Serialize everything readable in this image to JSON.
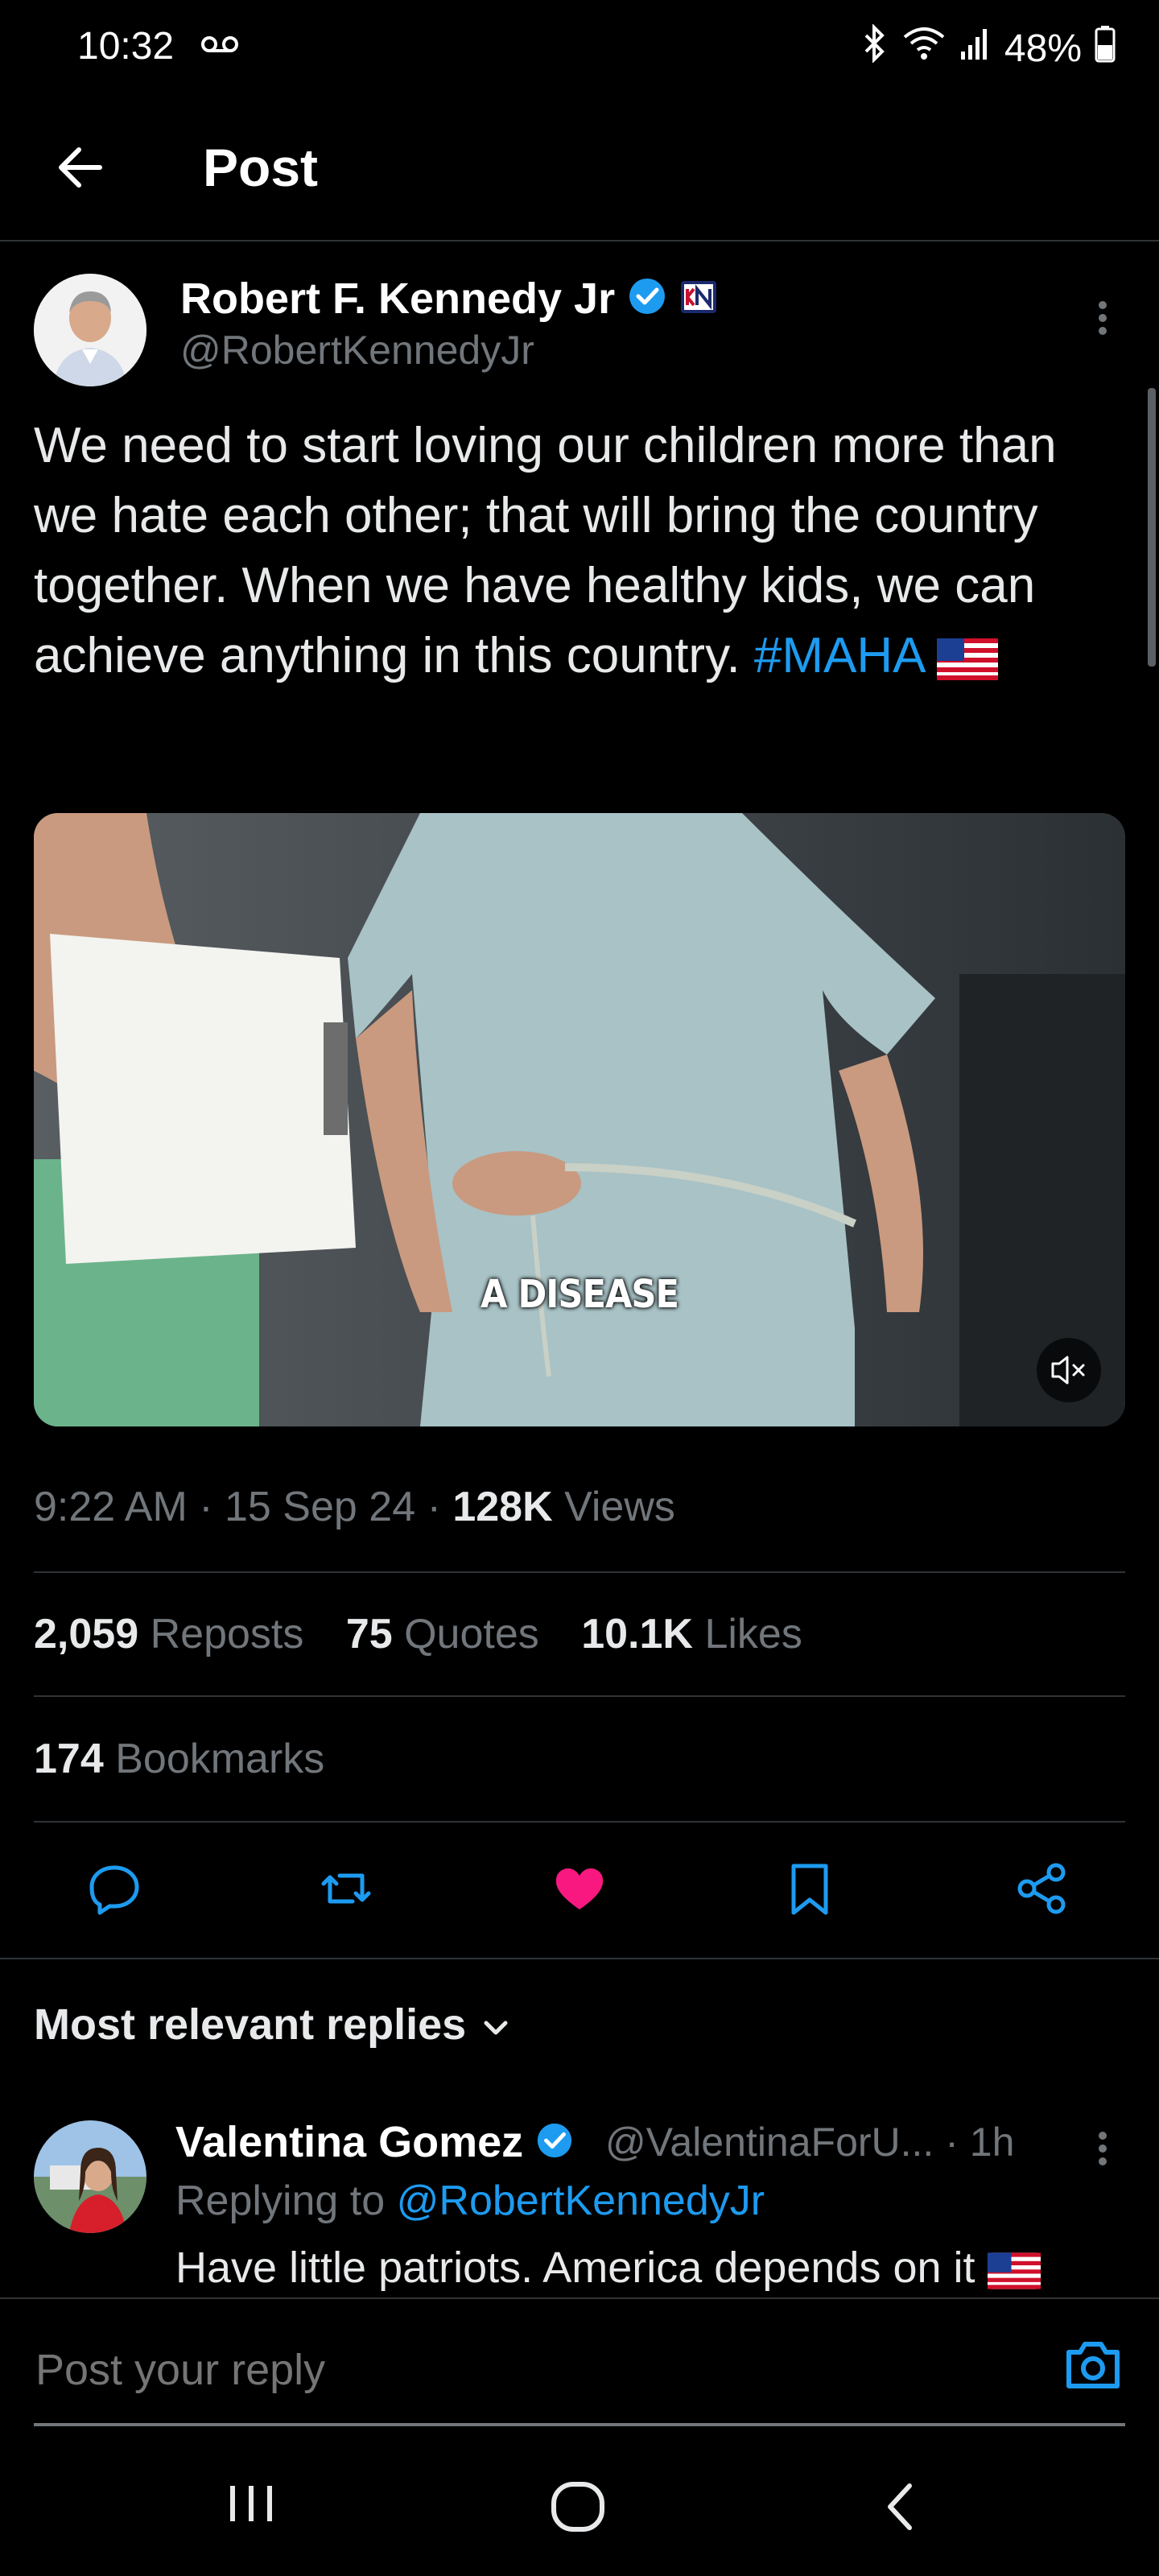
{
  "status_bar": {
    "time": "10:32",
    "battery": "48%"
  },
  "header": {
    "title": "Post"
  },
  "post": {
    "author_name": "Robert F. Kennedy Jr",
    "author_handle": "@RobertKennedyJr",
    "text": "We need to start loving our children more than we hate each other; that will bring the country together. When we have healthy kids, we can achieve anything in this country.",
    "hashtag": "#MAHA",
    "video_caption": "A DISEASE",
    "time": "9:22 AM",
    "date": "15 Sep 24",
    "views_count": "128K",
    "views_label": "Views",
    "reposts_count": "2,059",
    "reposts_label": "Reposts",
    "quotes_count": "75",
    "quotes_label": "Quotes",
    "likes_count": "10.1K",
    "likes_label": "Likes",
    "bookmarks_count": "174",
    "bookmarks_label": "Bookmarks"
  },
  "replies": {
    "sort_label": "Most relevant replies",
    "items": [
      {
        "name": "Valentina Gomez",
        "handle": "@ValentinaForU...",
        "time": "· 1h",
        "replying_prefix": "Replying to",
        "replying_to": "@RobertKennedyJr",
        "text": "Have little patriots. America depends on it"
      }
    ]
  },
  "composer": {
    "placeholder": "Post your reply"
  },
  "colors": {
    "accent": "#1d9bf0",
    "like": "#f91880",
    "background": "#000000",
    "muted": "#71767b"
  }
}
